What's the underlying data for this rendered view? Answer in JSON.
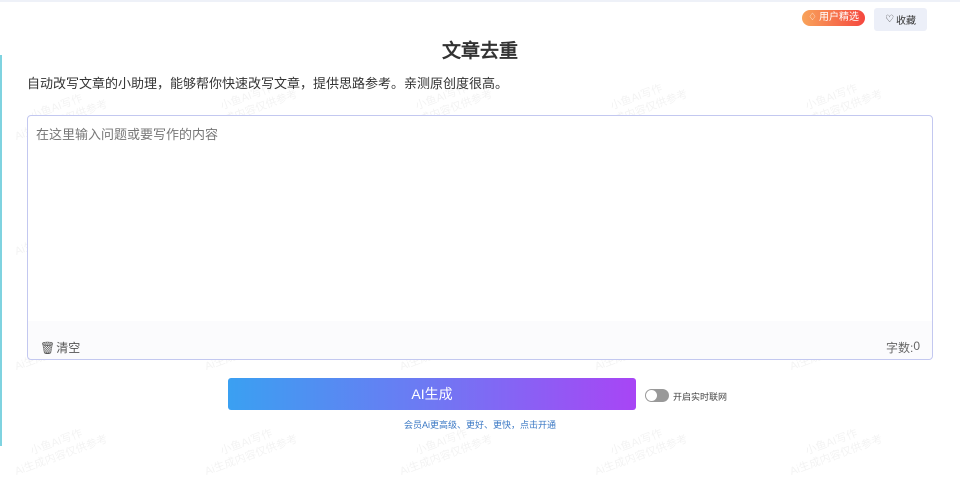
{
  "header": {
    "badge_label": "用户精选",
    "favorite_label": "收藏"
  },
  "page": {
    "title": "文章去重",
    "description": "自动改写文章的小助理，能够帮你快速改写文章，提供思路参考。亲测原创度很高。"
  },
  "editor": {
    "placeholder": "在这里输入问题或要写作的内容",
    "value": "",
    "clear_label": "清空",
    "count_label": "字数:",
    "count_value": "0"
  },
  "actions": {
    "generate_label": "AI生成",
    "online_toggle_label": "开启实时联网",
    "online_enabled": false,
    "vip_link": "会员Ai更高级、更好、更快，点击开通"
  },
  "watermark": {
    "line1": "小鱼AI写作",
    "line2": "Ai生成内容仅供参考"
  }
}
